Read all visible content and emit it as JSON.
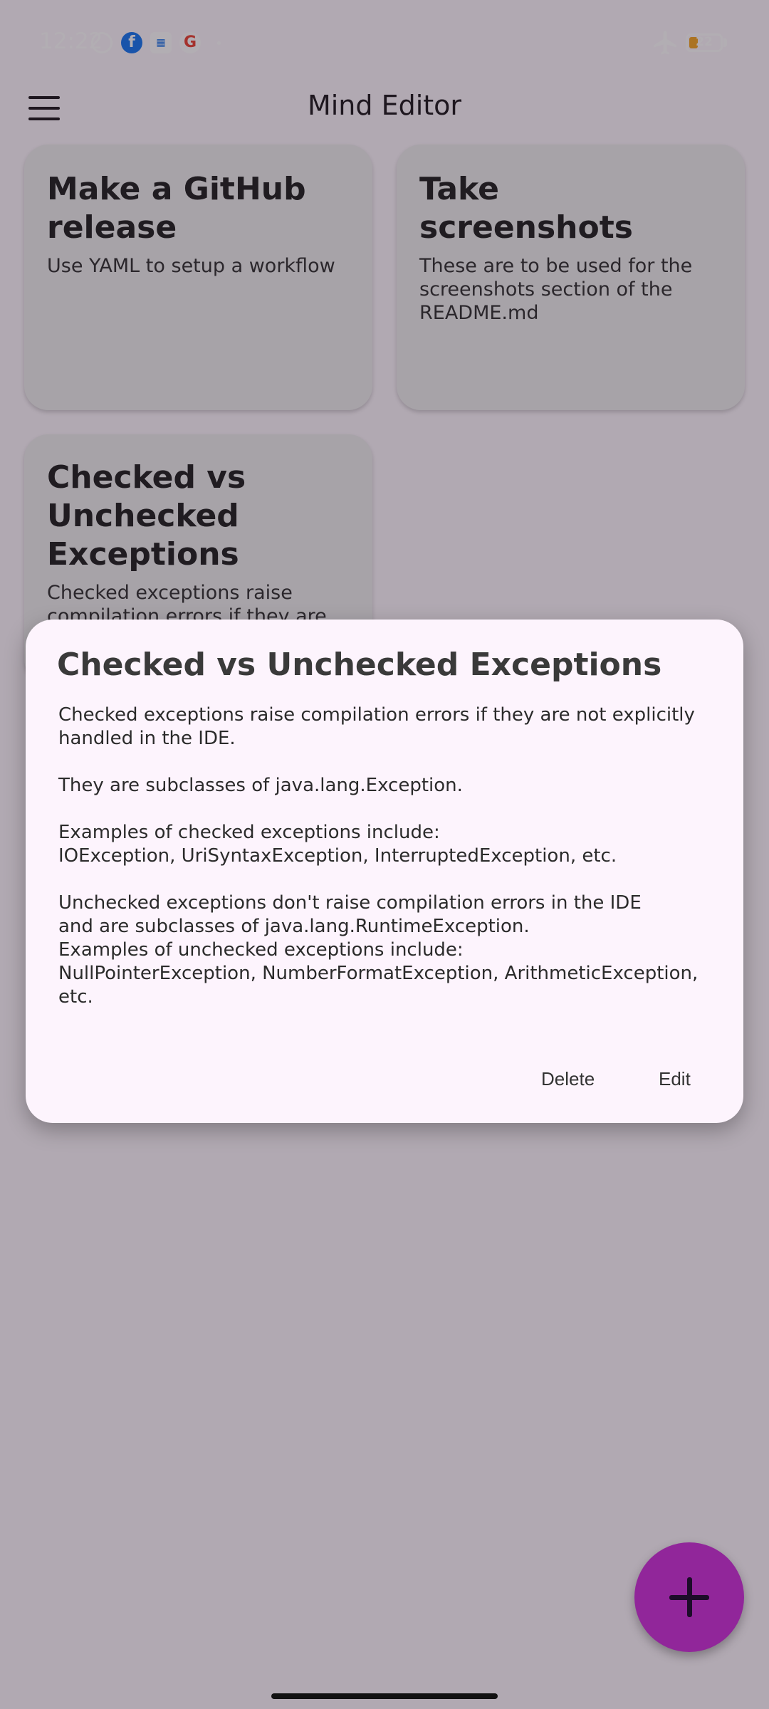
{
  "status_bar": {
    "time": "12:22",
    "battery_level": "22",
    "icons": [
      "alarm-icon",
      "facebook-icon",
      "calendar-icon",
      "google-icon",
      "airplane-mode-icon",
      "battery-icon"
    ]
  },
  "app_bar": {
    "title": "Mind Editor",
    "menu_icon": "hamburger-menu-icon"
  },
  "notes": [
    {
      "title": "Make a GitHub release",
      "body": "Use YAML to setup a workflow"
    },
    {
      "title": "Take screenshots",
      "body": "These are to be used for the screenshots section of the README.md"
    },
    {
      "title": "Checked vs Unchecked Exceptions",
      "body": "Checked exceptions raise compilation errors if they are not"
    }
  ],
  "dialog": {
    "title": "Checked vs Unchecked Exceptions",
    "body": {
      "p1_line1": "Checked exceptions raise compilation errors if they are not explicitly",
      "p1_line2": "handled in the IDE.",
      "p2": "They are subclasses of java.lang.Exception.",
      "p3_line1": "Examples of checked exceptions include:",
      "p3_line2": "IOException, UriSyntaxException, InterruptedException, etc.",
      "p4_line1": "Unchecked exceptions don't raise compilation errors in the IDE",
      "p4_line2": "and are subclasses of java.lang.RuntimeException.",
      "p4_line3": "Examples of unchecked exceptions include:",
      "p4_line4": "NullPointerException, NumberFormatException, ArithmeticException, etc."
    },
    "delete_label": "Delete",
    "edit_label": "Edit"
  },
  "fab": {
    "icon": "plus-icon"
  },
  "colors": {
    "fab": "#cd31d9",
    "dialog_background": "#fdf4fd",
    "card_background": "#eeeeee"
  }
}
